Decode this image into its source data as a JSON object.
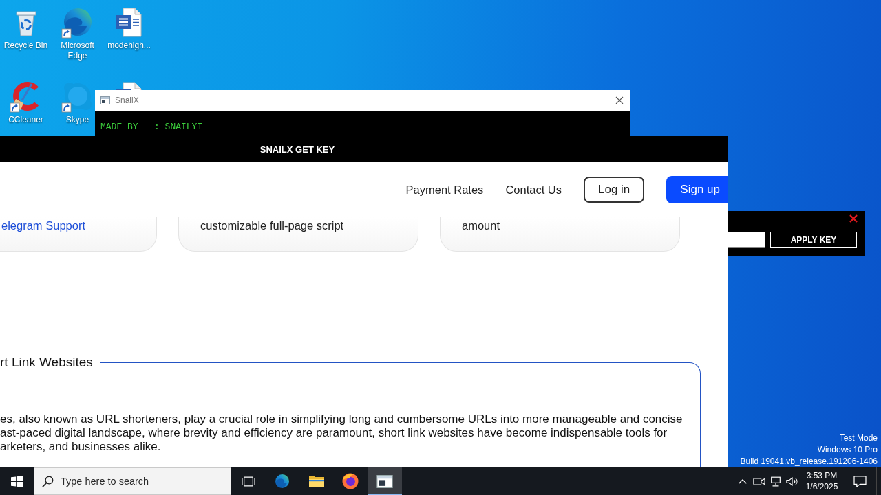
{
  "desktop": {
    "icons": [
      {
        "label": "Recycle Bin",
        "kind": "recycle-bin",
        "shortcut": false
      },
      {
        "label": "Microsoft Edge",
        "kind": "edge",
        "shortcut": true
      },
      {
        "label": "modehigh...",
        "kind": "word-doc",
        "shortcut": false
      },
      {
        "label": "CCleaner",
        "kind": "ccleaner",
        "shortcut": true
      },
      {
        "label": "Skype",
        "kind": "skype",
        "shortcut": true
      },
      {
        "kind": "word-doc"
      }
    ],
    "test_mode_notice": [
      "Test Mode",
      "Windows 10 Pro",
      "Build 19041.vb_release.191206-1406"
    ]
  },
  "console_window": {
    "title": "SnailX",
    "lines": [
      "MADE BY   : SNAILYT"
    ]
  },
  "key_window": {
    "title": "SNAILX GET KEY",
    "nav": {
      "links": [
        "Payment Rates",
        "Contact Us"
      ],
      "buttons": [
        {
          "label": "Log in",
          "kind": "outline"
        },
        {
          "label": "Sign up",
          "kind": "primary"
        }
      ]
    },
    "cards": [
      {
        "text": "elegram Support",
        "kind": "link"
      },
      {
        "text": "customizable full-page script",
        "kind": "text"
      },
      {
        "text": "amount",
        "kind": "text"
      }
    ],
    "section": {
      "heading": "rt Link Websites",
      "paragraph": [
        "es, also known as URL shorteners, play a crucial role in simplifying long and cumbersome URLs into more manageable and concise",
        "ast-paced digital landscape, where brevity and efficiency are paramount, short link websites have become indispensable tools for",
        "arketers, and businesses alike."
      ]
    }
  },
  "key_panel": {
    "apply_button": "APPLY KEY"
  },
  "taskbar": {
    "search": {
      "placeholder": "Type here to search"
    },
    "apps": [
      {
        "kind": "edge",
        "selected": false
      },
      {
        "kind": "file-explorer",
        "selected": false
      },
      {
        "kind": "firefox",
        "selected": false
      },
      {
        "kind": "console",
        "selected": true
      }
    ],
    "clock": {
      "time": "3:53 PM",
      "date": "1/6/2025"
    }
  }
}
